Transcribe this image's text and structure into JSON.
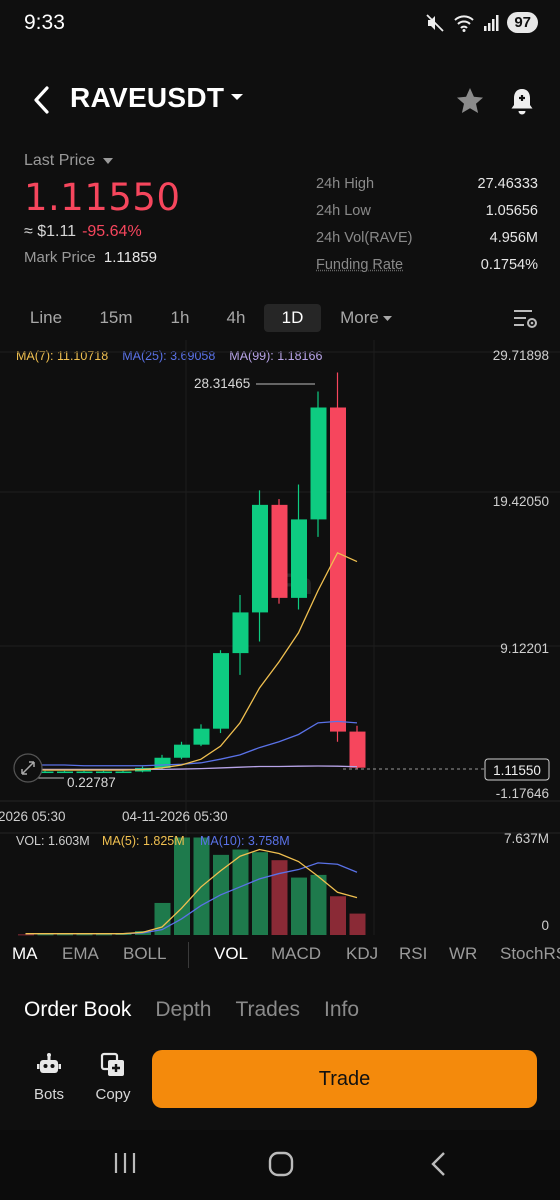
{
  "status": {
    "time": "9:33",
    "battery": "97"
  },
  "header": {
    "symbol": "RAVEUSDT"
  },
  "price": {
    "label": "Last Price",
    "last": "1.11550",
    "approx": "≈ $1.11",
    "change": "-95.64%",
    "mark_label": "Mark Price",
    "mark_value": "1.11859"
  },
  "stats": [
    {
      "label": "24h High",
      "value": "27.46333"
    },
    {
      "label": "24h Low",
      "value": "1.05656"
    },
    {
      "label": "24h Vol(RAVE)",
      "value": "4.956M"
    },
    {
      "label": "Funding Rate",
      "value": "0.1754%"
    }
  ],
  "timeframes": [
    "Line",
    "15m",
    "1h",
    "4h",
    "1D",
    "More"
  ],
  "active_timeframe": "1D",
  "ma_legend": [
    {
      "label": "MA(7): 11.10718",
      "color": "#f0c050"
    },
    {
      "label": "MA(25): 3.69058",
      "color": "#5a72e8"
    },
    {
      "label": "MA(99): 1.18166",
      "color": "#b8a4e8"
    }
  ],
  "chart": {
    "price_axis": [
      "29.71898",
      "19.42050",
      "9.12201",
      "-1.17646"
    ],
    "current_price_tag": "1.11550",
    "high_annotation": "28.31465",
    "low_annotation": "0.22787",
    "time_axis": [
      "2026 05:30",
      "04-11-2026 05:30"
    ],
    "vol_legend": [
      {
        "label": "VOL: 1.603M",
        "color": "#cfcfcf"
      },
      {
        "label": "MA(5): 1.825M",
        "color": "#f0c050"
      },
      {
        "label": "MA(10): 3.758M",
        "color": "#5a72e8"
      }
    ],
    "vol_axis": [
      "7.637M",
      "0"
    ],
    "colors": {
      "up": "#0ecb81",
      "down": "#f6465d",
      "up_vol": "#1e7a4c",
      "down_vol": "#8a2a36"
    },
    "candles": [
      {
        "o": 0.9,
        "h": 0.95,
        "l": 0.8,
        "c": 0.85
      },
      {
        "o": 0.85,
        "h": 0.9,
        "l": 0.8,
        "c": 0.85
      },
      {
        "o": 0.85,
        "h": 0.9,
        "l": 0.8,
        "c": 0.85
      },
      {
        "o": 0.85,
        "h": 0.9,
        "l": 0.8,
        "c": 0.85
      },
      {
        "o": 0.85,
        "h": 0.9,
        "l": 0.8,
        "c": 0.85
      },
      {
        "o": 0.85,
        "h": 0.9,
        "l": 0.8,
        "c": 0.85
      },
      {
        "o": 0.85,
        "h": 1.2,
        "l": 0.8,
        "c": 1.1
      },
      {
        "o": 1.1,
        "h": 2.0,
        "l": 1.0,
        "c": 1.8
      },
      {
        "o": 1.8,
        "h": 2.9,
        "l": 1.7,
        "c": 2.7
      },
      {
        "o": 2.7,
        "h": 4.1,
        "l": 2.6,
        "c": 3.8
      },
      {
        "o": 3.8,
        "h": 9.2,
        "l": 3.5,
        "c": 9.0
      },
      {
        "o": 9.0,
        "h": 13.0,
        "l": 7.5,
        "c": 11.8
      },
      {
        "o": 11.8,
        "h": 20.2,
        "l": 9.8,
        "c": 19.2
      },
      {
        "o": 19.2,
        "h": 19.6,
        "l": 12.4,
        "c": 12.8
      },
      {
        "o": 12.8,
        "h": 20.6,
        "l": 12.0,
        "c": 18.2
      },
      {
        "o": 18.2,
        "h": 27.0,
        "l": 17.0,
        "c": 25.9
      },
      {
        "o": 25.9,
        "h": 28.31,
        "l": 2.9,
        "c": 3.6
      },
      {
        "o": 3.6,
        "h": 4.0,
        "l": 1.06,
        "c": 1.1155
      }
    ],
    "ma7": [
      1.0,
      0.95,
      0.95,
      0.95,
      0.95,
      0.95,
      0.98,
      1.1,
      1.3,
      1.7,
      2.6,
      4.2,
      6.6,
      8.4,
      10.4,
      13.3,
      15.9,
      15.3
    ],
    "ma25": [
      1.3,
      1.3,
      1.3,
      1.25,
      1.25,
      1.25,
      1.25,
      1.3,
      1.35,
      1.45,
      1.7,
      2.0,
      2.5,
      2.9,
      3.4,
      4.2,
      4.3,
      4.2
    ],
    "ma99": [
      1.0,
      1.0,
      1.0,
      1.0,
      1.0,
      1.0,
      1.0,
      1.0,
      1.02,
      1.05,
      1.1,
      1.15,
      1.2,
      1.2,
      1.22,
      1.23,
      1.22,
      1.18
    ],
    "volumes": [
      0.05,
      0.05,
      0.05,
      0.05,
      0.05,
      0.1,
      0.3,
      2.4,
      7.3,
      7.3,
      6.0,
      6.4,
      6.2,
      5.6,
      4.3,
      4.5,
      2.9,
      1.603
    ],
    "vol_ma5": [
      0.1,
      0.1,
      0.1,
      0.1,
      0.1,
      0.1,
      0.2,
      0.6,
      2.0,
      3.6,
      4.8,
      5.9,
      6.4,
      6.1,
      5.5,
      4.4,
      3.2,
      2.8
    ],
    "vol_ma10": [
      0.1,
      0.1,
      0.1,
      0.1,
      0.1,
      0.1,
      0.15,
      0.4,
      1.2,
      2.2,
      3.0,
      3.6,
      4.2,
      4.6,
      4.9,
      5.4,
      5.3,
      4.7
    ]
  },
  "indicators": [
    "MA",
    "EMA",
    "BOLL",
    "VOL",
    "MACD",
    "KDJ",
    "RSI",
    "WR",
    "StochRSI"
  ],
  "active_indicators": [
    "MA",
    "VOL"
  ],
  "sections": [
    "Order Book",
    "Depth",
    "Trades",
    "Info"
  ],
  "active_section": "Order Book",
  "actions": {
    "bots": "Bots",
    "copy": "Copy",
    "trade": "Trade"
  }
}
